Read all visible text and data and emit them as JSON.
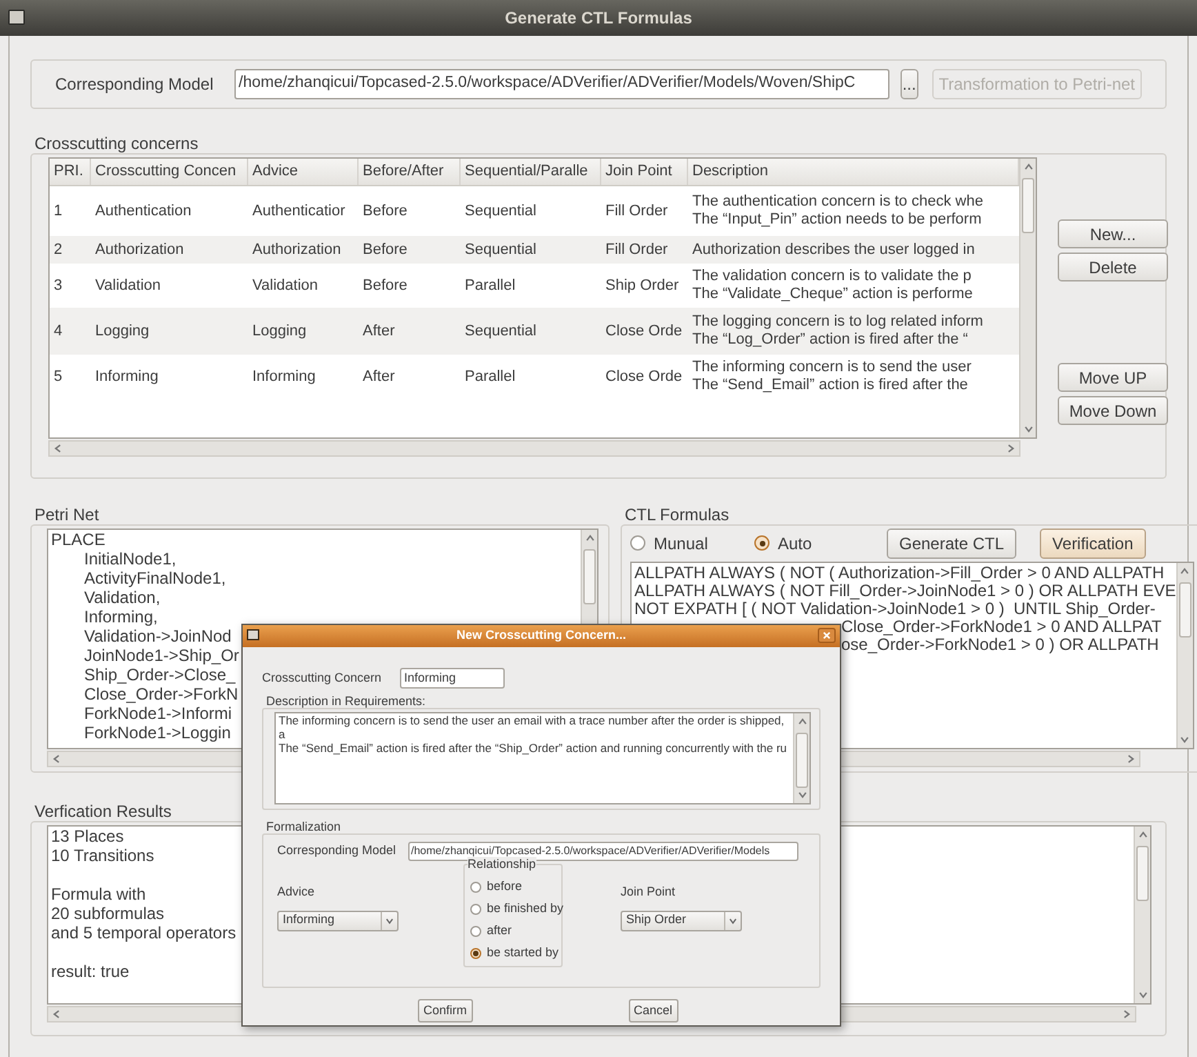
{
  "window": {
    "title": "Generate CTL Formulas"
  },
  "model": {
    "label": "Corresponding Model",
    "path": "/home/zhanqicui/Topcased-2.5.0/workspace/ADVerifier/ADVerifier/Models/Woven/ShipC",
    "browse": "...",
    "transform": {
      "label": "Transformation to Petri-net",
      "disabled": true
    }
  },
  "concerns": {
    "title": "Crosscutting concerns",
    "columns": [
      "PRI.",
      "Crosscutting Concen",
      "Advice",
      "Before/After",
      "Sequential/Paralle",
      "Join Point",
      "Description"
    ],
    "rows": [
      {
        "cells": [
          "1",
          "Authentication",
          "Authenticatior",
          "Before",
          "Sequential",
          "Fill Order"
        ],
        "description": [
          "The authentication concern is to check whe",
          "The “Input_Pin” action needs to be perform"
        ]
      },
      {
        "cells": [
          "2",
          "Authorization",
          "Authorization",
          "Before",
          "Sequential",
          "Fill Order"
        ],
        "description": [
          "Authorization describes the user logged in"
        ]
      },
      {
        "cells": [
          "3",
          "Validation",
          "Validation",
          "Before",
          "Parallel",
          "Ship Order"
        ],
        "description": [
          "The validation concern is to validate the p",
          "The “Validate_Cheque” action is performe"
        ]
      },
      {
        "cells": [
          "4",
          "Logging",
          "Logging",
          "After",
          "Sequential",
          "Close Orde"
        ],
        "description": [
          "The logging concern is to log related inform",
          "The “Log_Order” action is fired after the “"
        ]
      },
      {
        "cells": [
          "5",
          "Informing",
          "Informing",
          "After",
          "Parallel",
          "Close Orde"
        ],
        "description": [
          "The informing concern is to send the user",
          "The “Send_Email” action is fired after the"
        ]
      }
    ],
    "buttons": [
      {
        "label": "New..."
      },
      {
        "label": "Delete"
      },
      {
        "label": "Move UP"
      },
      {
        "label": "Move Down"
      }
    ]
  },
  "petri_net": {
    "title": "Petri Net",
    "items": [
      {
        "text": "PLACE",
        "children": [
          {
            "text": "InitialNode1,"
          },
          {
            "text": "ActivityFinalNode1,"
          },
          {
            "text": "Validation,"
          },
          {
            "text": "Informing,"
          },
          {
            "text": "Validation->JoinNod"
          },
          {
            "text": "JoinNode1->Ship_Or"
          },
          {
            "text": "Ship_Order->Close_"
          },
          {
            "text": "Close_Order->ForkN"
          },
          {
            "text": "ForkNode1->Informi"
          },
          {
            "text": "ForkNode1->Loggin"
          }
        ]
      }
    ]
  },
  "ctl": {
    "title": "CTL Formulas",
    "modes": [
      {
        "label": "Munual",
        "selected": false
      },
      {
        "label": "Auto",
        "selected": true
      }
    ],
    "buttons": [
      {
        "label": "Generate CTL",
        "highlighted": false
      },
      {
        "label": "Verification",
        "highlighted": true
      }
    ],
    "formulas": [
      {
        "text": "ALLPATH ALWAYS ( NOT ( Authorization->Fill_Order > 0 AND ALLPATH",
        "kind": "full"
      },
      {
        "text": "ALLPATH ALWAYS ( NOT Fill_Order->JoinNode1 > 0 ) OR ALLPATH EVE",
        "kind": "full"
      },
      {
        "text": "NOT EXPATH [ ( NOT Validation->JoinNode1 > 0 )  UNTIL Ship_Order-",
        "kind": "full"
      },
      {
        "text": "Close_Order->ForkNode1 > 0 AND ALLPAT",
        "kind": "partial"
      },
      {
        "text": "ose_Order->ForkNode1 > 0 ) OR ALLPATH",
        "kind": "partial"
      }
    ]
  },
  "results": {
    "title": "Verfication Results",
    "paragraphs": [
      [
        "13 Places",
        "10 Transitions"
      ],
      [
        "Formula with",
        "20 subformulas",
        "and 5 temporal operators"
      ],
      [
        "result: true"
      ]
    ]
  },
  "dialog": {
    "title": "New Crosscutting Concern...",
    "concern_label": "Crosscutting Concern",
    "concern_value": "Informing",
    "description_title": "Description in Requirements:",
    "description": [
      "The informing concern is to send the user an email with a trace number after the order is shipped, a",
      "The “Send_Email” action is fired after the “Ship_Order” action and running concurrently with the ru"
    ],
    "formalization_title": "Formalization",
    "model_label": "Corresponding Model",
    "model_value": "/home/zhanqicui/Topcased-2.5.0/workspace/ADVerifier/ADVerifier/Models",
    "advice_label": "Advice",
    "advice_value": "Informing",
    "relationship_title": "Relationship",
    "relationships": [
      {
        "label": "before",
        "selected": false
      },
      {
        "label": "be finished by",
        "selected": false
      },
      {
        "label": "after",
        "selected": false
      },
      {
        "label": "be started by",
        "selected": true
      }
    ],
    "join_label": "Join Point",
    "join_value": "Ship Order",
    "buttons": [
      {
        "label": "Confirm"
      },
      {
        "label": "Cancel"
      }
    ]
  }
}
